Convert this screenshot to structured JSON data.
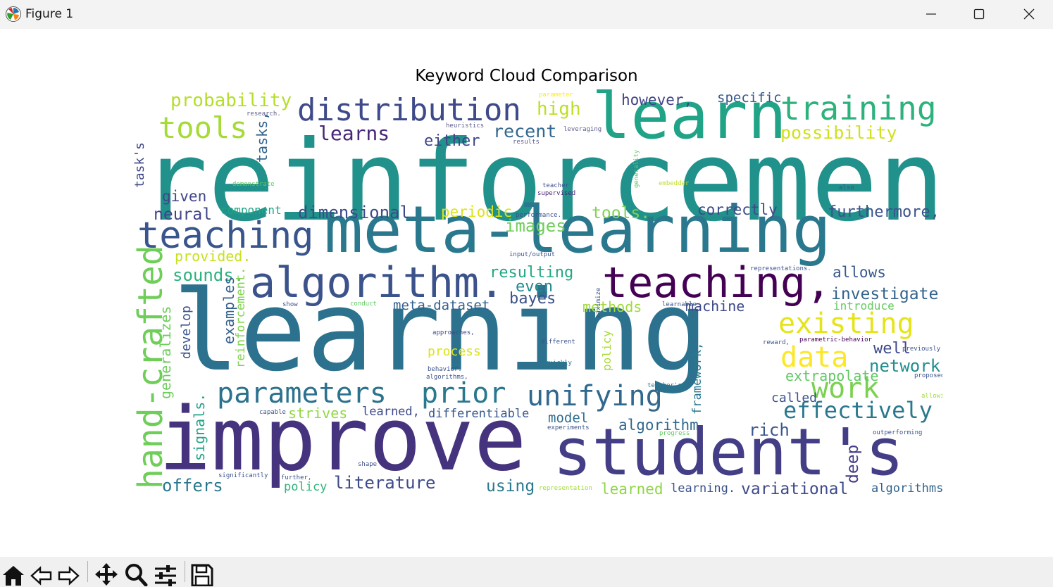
{
  "window": {
    "title": "Figure 1",
    "controls": [
      "minimize-icon",
      "maximize-icon",
      "close-icon"
    ]
  },
  "figure": {
    "title": "Keyword Cloud Comparison"
  },
  "chart_data": {
    "type": "wordcloud",
    "title": "Keyword Cloud Comparison",
    "colormap": "viridis",
    "background": "#ffffff",
    "words": [
      {
        "text": "reinforcement",
        "color": "#21918c"
      },
      {
        "text": "learning",
        "color": "#2c728e"
      },
      {
        "text": "improve",
        "color": "#46337e"
      },
      {
        "text": "meta-learning",
        "color": "#2a788e"
      },
      {
        "text": "student's",
        "color": "#433e85"
      },
      {
        "text": "learn",
        "color": "#20a386"
      },
      {
        "text": "teaching,",
        "color": "#440154"
      },
      {
        "text": "algorithm.",
        "color": "#3b528b"
      },
      {
        "text": "teaching",
        "color": "#39568c"
      },
      {
        "text": "hand-crafted",
        "color": "#6ece58"
      },
      {
        "text": "training",
        "color": "#2db27d"
      },
      {
        "text": "distribution",
        "color": "#3e4a89"
      },
      {
        "text": "tools",
        "color": "#a5db36"
      },
      {
        "text": "parameters",
        "color": "#2c728e"
      },
      {
        "text": "prior",
        "color": "#2a788e"
      },
      {
        "text": "unifying",
        "color": "#31688e"
      },
      {
        "text": "existing",
        "color": "#e5e419"
      },
      {
        "text": "work",
        "color": "#7ad151"
      },
      {
        "text": "data",
        "color": "#fde725"
      },
      {
        "text": "effectively",
        "color": "#2a788e"
      },
      {
        "text": "probability",
        "color": "#b5de2b"
      },
      {
        "text": "learns",
        "color": "#482677"
      },
      {
        "text": "high",
        "color": "#bddf26"
      },
      {
        "text": "recent",
        "color": "#31688e"
      },
      {
        "text": "possibility",
        "color": "#d0e11c"
      },
      {
        "text": "dimensional",
        "color": "#3e4a89"
      },
      {
        "text": "however,",
        "color": "#414487"
      },
      {
        "text": "specific",
        "color": "#38588c"
      },
      {
        "text": "either",
        "color": "#404688"
      },
      {
        "text": "periodic",
        "color": "#dde318"
      },
      {
        "text": "images",
        "color": "#6ece58"
      },
      {
        "text": "tools.",
        "color": "#7fd34e"
      },
      {
        "text": "correctly",
        "color": "#3e4a89"
      },
      {
        "text": "furthermore,",
        "color": "#3b528b"
      },
      {
        "text": "given",
        "color": "#404688"
      },
      {
        "text": "neural",
        "color": "#414487"
      },
      {
        "text": "component",
        "color": "#21a585"
      },
      {
        "text": "task's",
        "color": "#3f4788"
      },
      {
        "text": "tasks,",
        "color": "#33638d"
      },
      {
        "text": "provided.",
        "color": "#c8e020"
      },
      {
        "text": "sounds.",
        "color": "#2db27d"
      },
      {
        "text": "resulting",
        "color": "#22a884"
      },
      {
        "text": "even",
        "color": "#23898e"
      },
      {
        "text": "bayes",
        "color": "#3b528b"
      },
      {
        "text": "methods",
        "color": "#a0da39"
      },
      {
        "text": "machine",
        "color": "#3e4a89"
      },
      {
        "text": "allows",
        "color": "#38588c"
      },
      {
        "text": "investigate",
        "color": "#33638d"
      },
      {
        "text": "introduce",
        "color": "#63cb5f"
      },
      {
        "text": "examples",
        "color": "#35608d"
      },
      {
        "text": "generalizes",
        "color": "#6ccd5a"
      },
      {
        "text": "develop",
        "color": "#3b528b"
      },
      {
        "text": "reinforcement.",
        "color": "#7fd34e"
      },
      {
        "text": "meta-dataset",
        "color": "#34618d"
      },
      {
        "text": "process",
        "color": "#dde318"
      },
      {
        "text": "policy",
        "color": "#a8db34"
      },
      {
        "text": "well",
        "color": "#3e4989"
      },
      {
        "text": "network",
        "color": "#218e8d"
      },
      {
        "text": "extrapolate",
        "color": "#5ec962"
      },
      {
        "text": "called",
        "color": "#3b528b"
      },
      {
        "text": "framework,",
        "color": "#2a788e"
      },
      {
        "text": "signals.",
        "color": "#20a386"
      },
      {
        "text": "strives",
        "color": "#90d743"
      },
      {
        "text": "learned,",
        "color": "#3e4a89"
      },
      {
        "text": "differentiable",
        "color": "#38588c"
      },
      {
        "text": "model",
        "color": "#2f6c8e"
      },
      {
        "text": "algorithm",
        "color": "#31688e"
      },
      {
        "text": "rich",
        "color": "#39568c"
      },
      {
        "text": "deep",
        "color": "#433e85"
      },
      {
        "text": "offers",
        "color": "#2a788e"
      },
      {
        "text": "policy",
        "color": "#2fb47c"
      },
      {
        "text": "literature",
        "color": "#3e4989"
      },
      {
        "text": "using",
        "color": "#2a788e"
      },
      {
        "text": "learned",
        "color": "#8ed645"
      },
      {
        "text": "learning.",
        "color": "#3b528b"
      },
      {
        "text": "variational",
        "color": "#3e4a89"
      },
      {
        "text": "algorithms",
        "color": "#33638d"
      },
      {
        "text": "parameter",
        "color": "#fde725"
      },
      {
        "text": "research.",
        "color": "#5e5e8e"
      },
      {
        "text": "heuristics",
        "color": "#5e5e8e"
      },
      {
        "text": "results",
        "color": "#5e5e8e"
      },
      {
        "text": "leveraging",
        "color": "#5e5e8e"
      },
      {
        "text": "generality",
        "color": "#5ec962"
      },
      {
        "text": "demonstrate",
        "color": "#5ec962"
      },
      {
        "text": "teacher",
        "color": "#3b528b"
      },
      {
        "text": "supervised",
        "color": "#482677"
      },
      {
        "text": "embedder",
        "color": "#bddf26"
      },
      {
        "text": "also",
        "color": "#3b528b"
      },
      {
        "text": "performance.",
        "color": "#3b528b"
      },
      {
        "text": "input/output",
        "color": "#3b528b"
      },
      {
        "text": "representations.",
        "color": "#3b528b"
      },
      {
        "text": "show",
        "color": "#3b528b"
      },
      {
        "text": "conduct",
        "color": "#5ec962"
      },
      {
        "text": "learnable",
        "color": "#3b528b"
      },
      {
        "text": "maximize",
        "color": "#3b528b"
      },
      {
        "text": "approaches,",
        "color": "#3e4a89"
      },
      {
        "text": "different",
        "color": "#3b528b"
      },
      {
        "text": "reward,",
        "color": "#3b528b"
      },
      {
        "text": "parametric-behavior",
        "color": "#440154"
      },
      {
        "text": "previously",
        "color": "#3b528b"
      },
      {
        "text": "quickly",
        "color": "#2a788e"
      },
      {
        "text": "behavior.",
        "color": "#3b528b"
      },
      {
        "text": "algorithms,",
        "color": "#3b528b"
      },
      {
        "text": "proposed",
        "color": "#3b528b"
      },
      {
        "text": "teacher's",
        "color": "#2a788e"
      },
      {
        "text": "allowing",
        "color": "#a0da39"
      },
      {
        "text": "capable",
        "color": "#3b528b"
      },
      {
        "text": "experiments",
        "color": "#3b528b"
      },
      {
        "text": "progress",
        "color": "#5ec962"
      },
      {
        "text": "outperforming",
        "color": "#3b528b"
      },
      {
        "text": "shape",
        "color": "#3b528b"
      },
      {
        "text": "significantly",
        "color": "#3b528b"
      },
      {
        "text": "further,",
        "color": "#3b528b"
      },
      {
        "text": "representation",
        "color": "#a0da39"
      }
    ]
  },
  "toolbar": {
    "buttons": [
      "home-icon",
      "back-icon",
      "forward-icon",
      "pan-icon",
      "zoom-icon",
      "configure-subplots-icon",
      "save-icon"
    ]
  }
}
